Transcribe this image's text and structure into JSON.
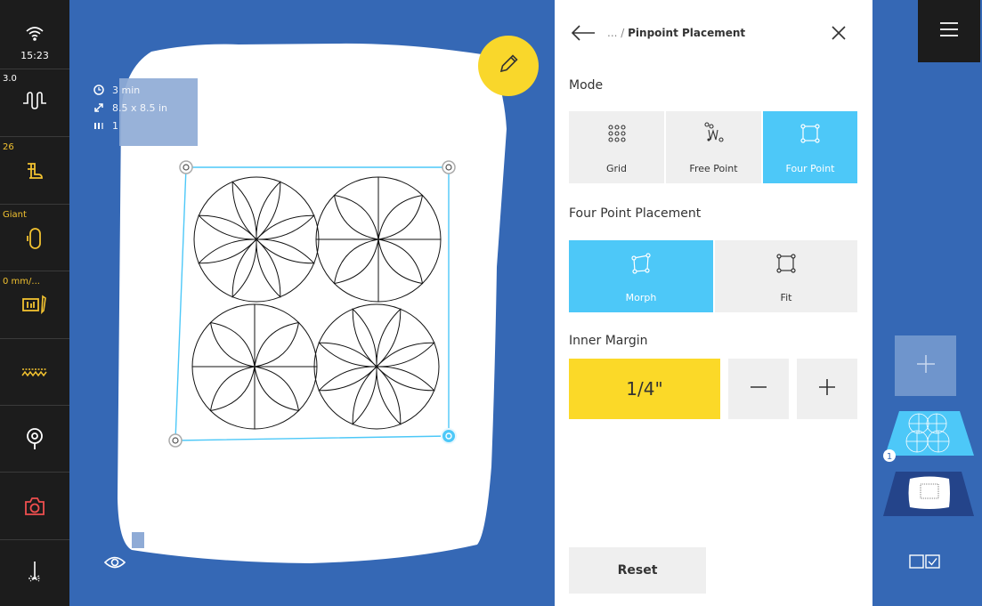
{
  "status_bar": {
    "time": "15:23",
    "stitch_length": "3.0",
    "speed": "26",
    "hoop": "Giant",
    "spacing": "0 mm/..."
  },
  "info": {
    "time": "3 min",
    "size": "8.5 x 8.5 in",
    "count": "1"
  },
  "panel": {
    "breadcrumb_prefix": "... / ",
    "title": "Pinpoint Placement",
    "mode_label": "Mode",
    "modes": [
      {
        "label": "Grid",
        "icon": "grid-points-icon",
        "selected": false
      },
      {
        "label": "Free Point",
        "icon": "free-point-icon",
        "selected": false
      },
      {
        "label": "Four Point",
        "icon": "four-point-icon",
        "selected": true
      }
    ],
    "placement_label": "Four Point Placement",
    "placements": [
      {
        "label": "Morph",
        "icon": "morph-icon",
        "selected": true
      },
      {
        "label": "Fit",
        "icon": "fit-icon",
        "selected": false
      }
    ],
    "inner_margin_label": "Inner Margin",
    "inner_margin_value": "1/4\"",
    "reset_label": "Reset"
  },
  "layers": {
    "badge": "1"
  },
  "colors": {
    "accent": "#4dc8f8",
    "highlight": "#f9d72b",
    "background": "#3568b5",
    "dark": "#1c1c1c"
  }
}
